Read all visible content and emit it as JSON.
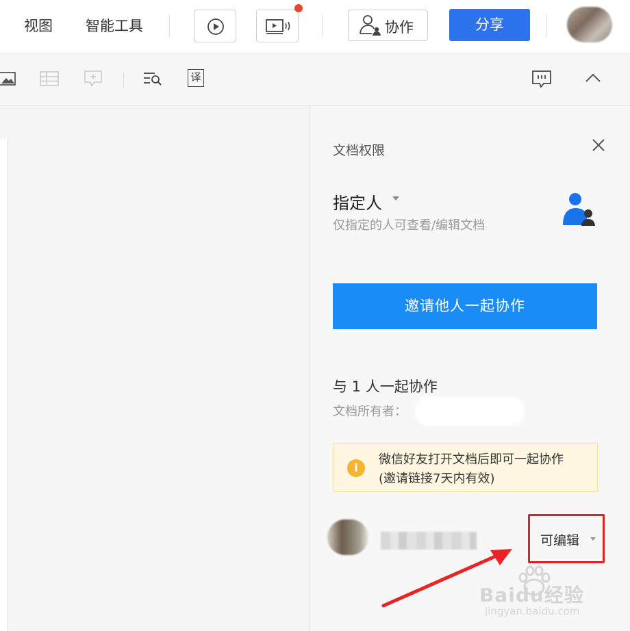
{
  "header": {
    "menu": [
      "视图",
      "智能工具"
    ],
    "collab_label": "协作",
    "share_label": "分享",
    "icons": [
      "play-icon",
      "present-icon",
      "collab-user-icon",
      "avatar"
    ]
  },
  "toolbar": {
    "icons": [
      "image-icon",
      "table-icon",
      "comment-add-icon",
      "find-icon",
      "translate-icon",
      "comment-icon",
      "collapse-icon"
    ],
    "translate_glyph": "译"
  },
  "panel": {
    "title": "文档权限",
    "permission": "指定人",
    "permission_desc": "仅指定的人可查看/编辑文档",
    "invite_label": "邀请他人一起协作",
    "collab_count": "与 1 人一起协作",
    "owner_label": "文档所有者：",
    "notice": {
      "line1": "微信好友打开文档后即可一起协作",
      "line2": "(邀请链接7天内有效)"
    },
    "member_role": "可编辑"
  },
  "watermark": {
    "brand": "Baidu经验",
    "url": "jingyan.baidu.com"
  },
  "colors": {
    "share_blue": "#2d73ee",
    "invite_blue": "#1a8cf5",
    "notice_bg": "#fff7e1",
    "highlight_red": "#e02020"
  }
}
